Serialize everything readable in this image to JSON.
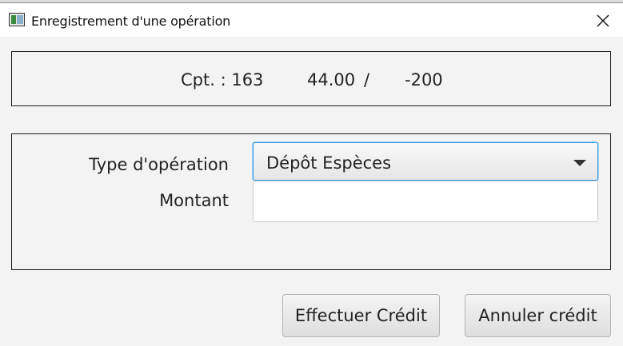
{
  "window": {
    "title": "Enregistrement d'une opération",
    "icon": "app-window-icon",
    "close_icon": "close-icon"
  },
  "info": {
    "compte": "Cpt. : 163",
    "solde": "44.00",
    "separator": "/",
    "decouvert": "-200"
  },
  "form": {
    "type_label": "Type d'opération",
    "type_value": "Dépôt Espèces",
    "montant_label": "Montant",
    "montant_value": ""
  },
  "buttons": {
    "ok_label": "Effectuer Crédit",
    "cancel_label": "Annuler crédit"
  },
  "colors": {
    "focus_accent": "#2e9ae4",
    "background": "#f3f3f3"
  }
}
